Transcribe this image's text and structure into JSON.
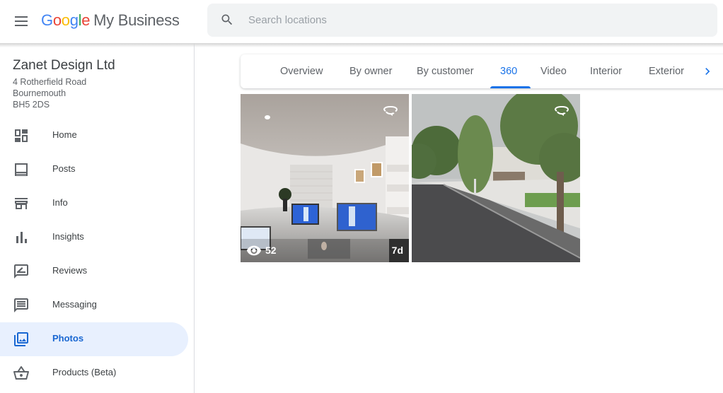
{
  "header": {
    "logo_letters": [
      "G",
      "o",
      "o",
      "g",
      "l",
      "e"
    ],
    "product_name": "My Business",
    "search_placeholder": "Search locations",
    "search_value": ""
  },
  "business": {
    "name": "Zanet Design Ltd",
    "address_lines": [
      "4 Rotherfield Road",
      "Bournemouth",
      "BH5 2DS"
    ]
  },
  "sidebar": {
    "items": [
      {
        "label": "Home",
        "icon": "dashboard-icon",
        "active": false
      },
      {
        "label": "Posts",
        "icon": "posts-icon",
        "active": false
      },
      {
        "label": "Info",
        "icon": "storefront-icon",
        "active": false
      },
      {
        "label": "Insights",
        "icon": "bar-chart-icon",
        "active": false
      },
      {
        "label": "Reviews",
        "icon": "rate-review-icon",
        "active": false
      },
      {
        "label": "Messaging",
        "icon": "message-icon",
        "active": false
      },
      {
        "label": "Photos",
        "icon": "photo-library-icon",
        "active": true
      },
      {
        "label": "Products (Beta)",
        "icon": "shopping-basket-icon",
        "active": false
      }
    ]
  },
  "tabs": {
    "items": [
      {
        "label": "Overview",
        "active": false
      },
      {
        "label": "By owner",
        "active": false
      },
      {
        "label": "By customer",
        "active": false
      },
      {
        "label": "360",
        "active": true
      },
      {
        "label": "Video",
        "active": false
      },
      {
        "label": "Interior",
        "active": false
      },
      {
        "label": "Exterior",
        "active": false
      }
    ],
    "next_icon": "chevron-right-icon"
  },
  "photos": [
    {
      "description": "360 office interior",
      "type_icon": "360-rotate-icon",
      "views": "52",
      "age": "7d"
    },
    {
      "description": "360 street view exterior",
      "type_icon": "360-rotate-icon",
      "views": "",
      "age": ""
    }
  ],
  "colors": {
    "accent": "#1a73e8",
    "active_nav_bg": "#e8f0fe",
    "active_nav_text": "#1967d2",
    "search_bg": "#f1f3f4"
  }
}
